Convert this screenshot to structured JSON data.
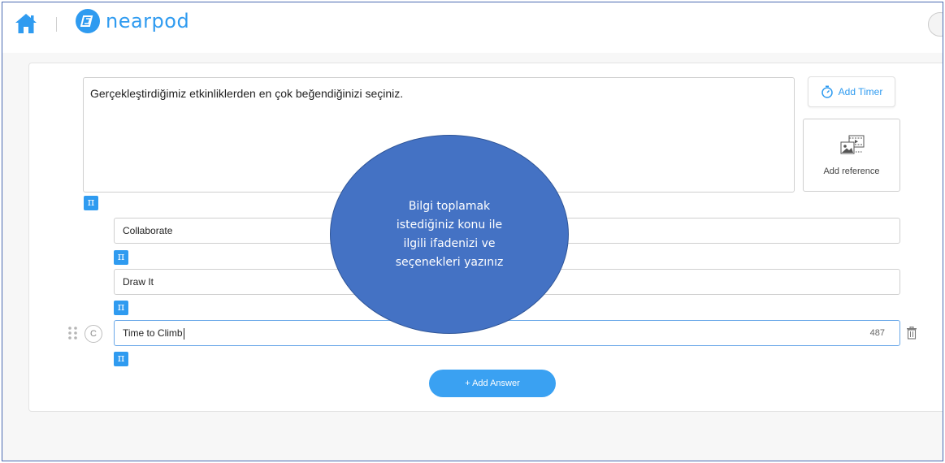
{
  "header": {
    "logo_text": "nearpod",
    "icons": {
      "home": "home-icon",
      "logo": "nearpod-logo-icon"
    }
  },
  "question": {
    "text": "Gerçekleştirdiğimiz etkinliklerden en çok beğendiğinizi seçiniz."
  },
  "side_actions": {
    "timer_label": "Add Timer",
    "reference_label": "Add reference"
  },
  "math_button_label": "π",
  "answers": [
    {
      "text": "Collaborate"
    },
    {
      "text": "Draw It"
    },
    {
      "text": "Time to Climb",
      "letter": "C",
      "char_count": "487"
    }
  ],
  "add_answer_label": "+ Add Answer",
  "callout": {
    "lines": [
      "Bilgi toplamak",
      "istediğiniz konu ile",
      "ilgili ifadenizi ve",
      "seçenekleri yazınız"
    ]
  },
  "colors": {
    "accent": "#2f9bf0",
    "callout_fill": "#4472c4"
  }
}
